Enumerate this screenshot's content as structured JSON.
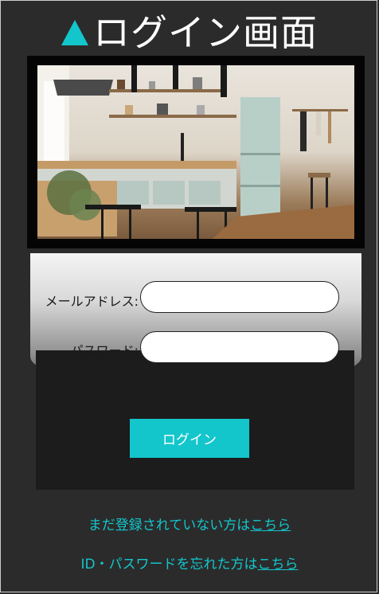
{
  "page": {
    "title": "ログイン画面",
    "title_icon": "triangle-icon",
    "accent_color": "#13c6cc"
  },
  "hero": {
    "image": "kitchen-photo"
  },
  "form": {
    "email_label": "メールアドレス:",
    "email_value": "",
    "password_label": "パスワード:",
    "password_value": "",
    "login_label": "ログイン"
  },
  "links": {
    "register_text": "まだ登録されていない方は",
    "register_link": "こちら",
    "forgot_text": "ID・パスワードを忘れた方は",
    "forgot_link": "こちら"
  }
}
